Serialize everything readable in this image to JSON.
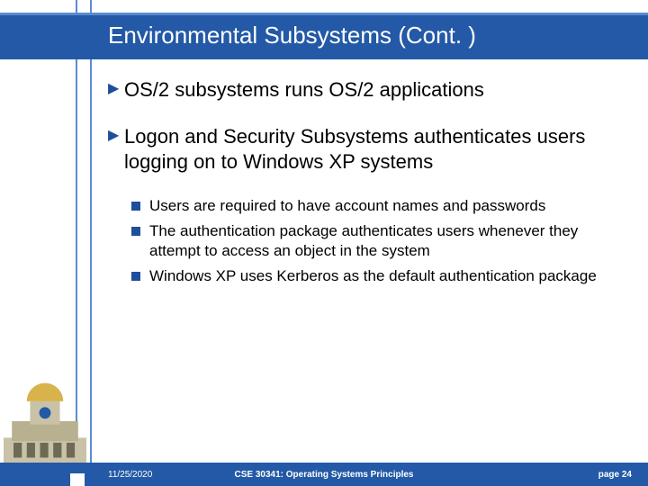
{
  "title": "Environmental Subsystems (Cont. )",
  "bullets": [
    {
      "text": "OS/2 subsystems runs OS/2 applications",
      "sub": []
    },
    {
      "text": "Logon and Security Subsystems authenticates users logging on to Windows XP systems",
      "sub": [
        "Users are required to have account names and passwords",
        "The authentication package authenticates users whenever they attempt to access an object in the system",
        "Windows XP uses Kerberos as the default authentication package"
      ]
    }
  ],
  "footer": {
    "date": "11/25/2020",
    "course": "CSE 30341: Operating Systems Principles",
    "page": "page 24"
  }
}
